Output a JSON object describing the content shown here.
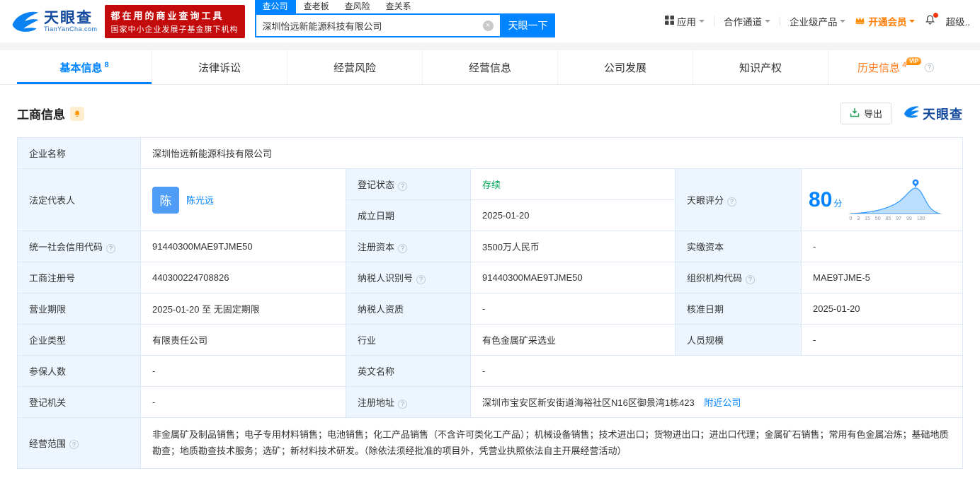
{
  "brand": {
    "name": "天眼查",
    "domain": "TianYanCha.com",
    "slogan1": "都在用的商业查询工具",
    "slogan2": "国家中小企业发展子基金旗下机构",
    "accent": "#0084ff",
    "badge_red": "#c30b0b"
  },
  "icons": {
    "help": "?",
    "clear": "×"
  },
  "search": {
    "tabs": [
      {
        "label": "查公司",
        "active": true
      },
      {
        "label": "查老板",
        "active": false
      },
      {
        "label": "查风险",
        "active": false
      },
      {
        "label": "查关系",
        "active": false
      }
    ],
    "value": "深圳怡远新能源科技有限公司",
    "button": "天眼一下"
  },
  "top_nav": {
    "apps": "应用",
    "partner": "合作通道",
    "enterprise": "企业级产品",
    "vip": "开通会员",
    "super": "超级.."
  },
  "tabs": [
    {
      "label": "基本信息",
      "count": "8",
      "active": true
    },
    {
      "label": "法律诉讼"
    },
    {
      "label": "经营风险"
    },
    {
      "label": "经营信息"
    },
    {
      "label": "公司发展"
    },
    {
      "label": "知识产权"
    },
    {
      "label": "历史信息",
      "count": "4",
      "vip": "VIP"
    }
  ],
  "section": {
    "title": "工商信息",
    "export": "导出"
  },
  "fields": {
    "company_name": {
      "label": "企业名称",
      "value": "深圳怡远新能源科技有限公司"
    },
    "legal_rep": {
      "label": "法定代表人",
      "avatar": "陈",
      "value": "陈光远"
    },
    "reg_status": {
      "label": "登记状态",
      "value": "存续"
    },
    "establish_date": {
      "label": "成立日期",
      "value": "2025-01-20"
    },
    "score": {
      "label": "天眼评分",
      "value": "80",
      "unit": "分",
      "axis": "0 3 15 50 85 97 99 100"
    },
    "credit_code": {
      "label": "统一社会信用代码",
      "value": "91440300MAE9TJME50"
    },
    "reg_capital": {
      "label": "注册资本",
      "value": "3500万人民币"
    },
    "paid_capital": {
      "label": "实缴资本",
      "value": "-"
    },
    "reg_number": {
      "label": "工商注册号",
      "value": "440300224708826"
    },
    "taxpayer_id": {
      "label": "纳税人识别号",
      "value": "91440300MAE9TJME50"
    },
    "org_code": {
      "label": "组织机构代码",
      "value": "MAE9TJME-5"
    },
    "business_term": {
      "label": "营业期限",
      "value": "2025-01-20 至 无固定期限"
    },
    "taxpayer_quality": {
      "label": "纳税人资质",
      "value": "-"
    },
    "approval_date": {
      "label": "核准日期",
      "value": "2025-01-20"
    },
    "company_type": {
      "label": "企业类型",
      "value": "有限责任公司"
    },
    "industry": {
      "label": "行业",
      "value": "有色金属矿采选业"
    },
    "staff_size": {
      "label": "人员规模",
      "value": "-"
    },
    "insured_count": {
      "label": "参保人数",
      "value": "-"
    },
    "english_name": {
      "label": "英文名称",
      "value": "-"
    },
    "reg_authority": {
      "label": "登记机关",
      "value": "-"
    },
    "reg_address": {
      "label": "注册地址",
      "value": "深圳市宝安区新安街道海裕社区N16区御景湾1栋423",
      "link": "附近公司"
    },
    "business_scope": {
      "label": "经营范围",
      "value": "非金属矿及制品销售；电子专用材料销售；电池销售；化工产品销售（不含许可类化工产品）；机械设备销售；技术进出口；货物进出口；进出口代理；金属矿石销售；常用有色金属冶炼；基础地质勘查；地质勘查技术服务；选矿；新材料技术研发。（除依法须经批准的项目外，凭营业执照依法自主开展经营活动）"
    }
  }
}
